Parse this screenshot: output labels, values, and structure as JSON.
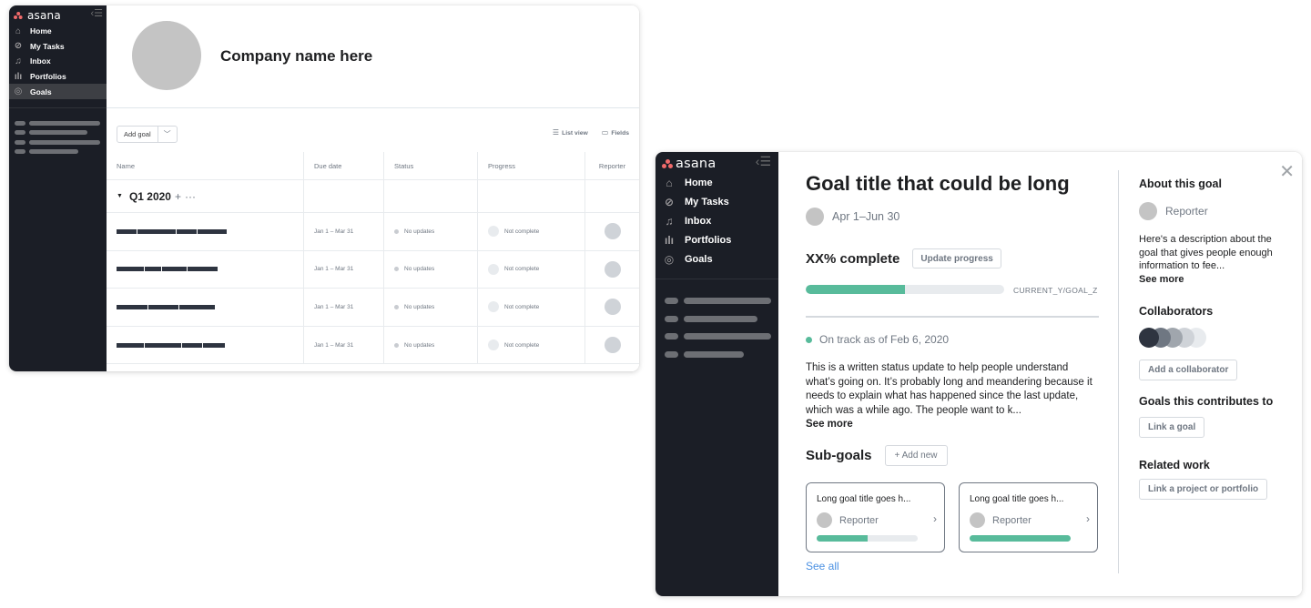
{
  "sidebar": {
    "brand": "asana",
    "collapse_icon": "collapse-menu-icon",
    "items": [
      {
        "label": "Home",
        "icon": "home-icon",
        "glyph": "⌂"
      },
      {
        "label": "My Tasks",
        "icon": "check-circle-icon",
        "glyph": "✓"
      },
      {
        "label": "Inbox",
        "icon": "bell-icon",
        "glyph": "🔔"
      },
      {
        "label": "Portfolios",
        "icon": "bar-chart-icon",
        "glyph": "|||"
      },
      {
        "label": "Goals",
        "icon": "goal-icon",
        "glyph": "◎"
      }
    ],
    "active_item": "Goals"
  },
  "goals_list": {
    "company_name": "Company name here",
    "toolbar": {
      "add_goal_label": "Add goal",
      "list_view_label": "List view",
      "fields_label": "Fields"
    },
    "columns": [
      "Name",
      "Due date",
      "Status",
      "Progress",
      "Reporter"
    ],
    "section": {
      "title": "Q1 2020"
    },
    "rows": [
      {
        "name_redacted": true,
        "due": "Jan 1 – Mar 31",
        "status": "No updates",
        "progress": "Not complete"
      },
      {
        "name_redacted": true,
        "due": "Jan 1 – Mar 31",
        "status": "No updates",
        "progress": "Not complete"
      },
      {
        "name_redacted": true,
        "due": "Jan 1 – Mar 31",
        "status": "No updates",
        "progress": "Not complete"
      },
      {
        "name_redacted": true,
        "due": "Jan 1 – Mar 31",
        "status": "No updates",
        "progress": "Not complete"
      }
    ]
  },
  "goal_detail": {
    "title": "Goal title that could be long",
    "date_range": "Apr 1–Jun 30",
    "progress_label": "XX% complete",
    "update_progress_label": "Update progress",
    "progress_fraction": 0.5,
    "progress_ratio_text": "CURRENT_Y/GOAL_Z",
    "status": {
      "text": "On track as of Feb 6, 2020",
      "color": "#58bb9b"
    },
    "status_body": "This is a written status update to help people understand what’s going on. It’s probably long and meandering because it needs to explain what has happened since the last update, which was a while ago. The people want to k...",
    "see_more_label": "See more",
    "subgoals": {
      "title": "Sub-goals",
      "add_new_label": "+ Add new",
      "cards": [
        {
          "title": "Long goal title goes h...",
          "reporter": "Reporter",
          "progress_fraction": 0.5
        },
        {
          "title": "Long goal title goes h...",
          "reporter": "Reporter",
          "progress_fraction": 1.0
        }
      ],
      "see_all_label": "See all"
    },
    "about": {
      "heading": "About this goal",
      "reporter": "Reporter",
      "description": "Here's a description about the goal that gives people enough information to fee...",
      "see_more_label": "See more"
    },
    "collaborators": {
      "heading": "Collaborators",
      "avatar_colors": [
        "#2e3440",
        "#6f7782",
        "#a0a6ad",
        "#cfd3d8",
        "#e8ebee"
      ],
      "add_label": "Add a collaborator"
    },
    "contributes": {
      "heading": "Goals this contributes to",
      "link_label": "Link a goal"
    },
    "related": {
      "heading": "Related work",
      "link_label": "Link a project or portfolio"
    }
  },
  "colors": {
    "sidebar_bg": "#1b1e26",
    "accent_green": "#58bb9b",
    "link_blue": "#4a90e2",
    "brand_coral": "#f06a6a"
  }
}
